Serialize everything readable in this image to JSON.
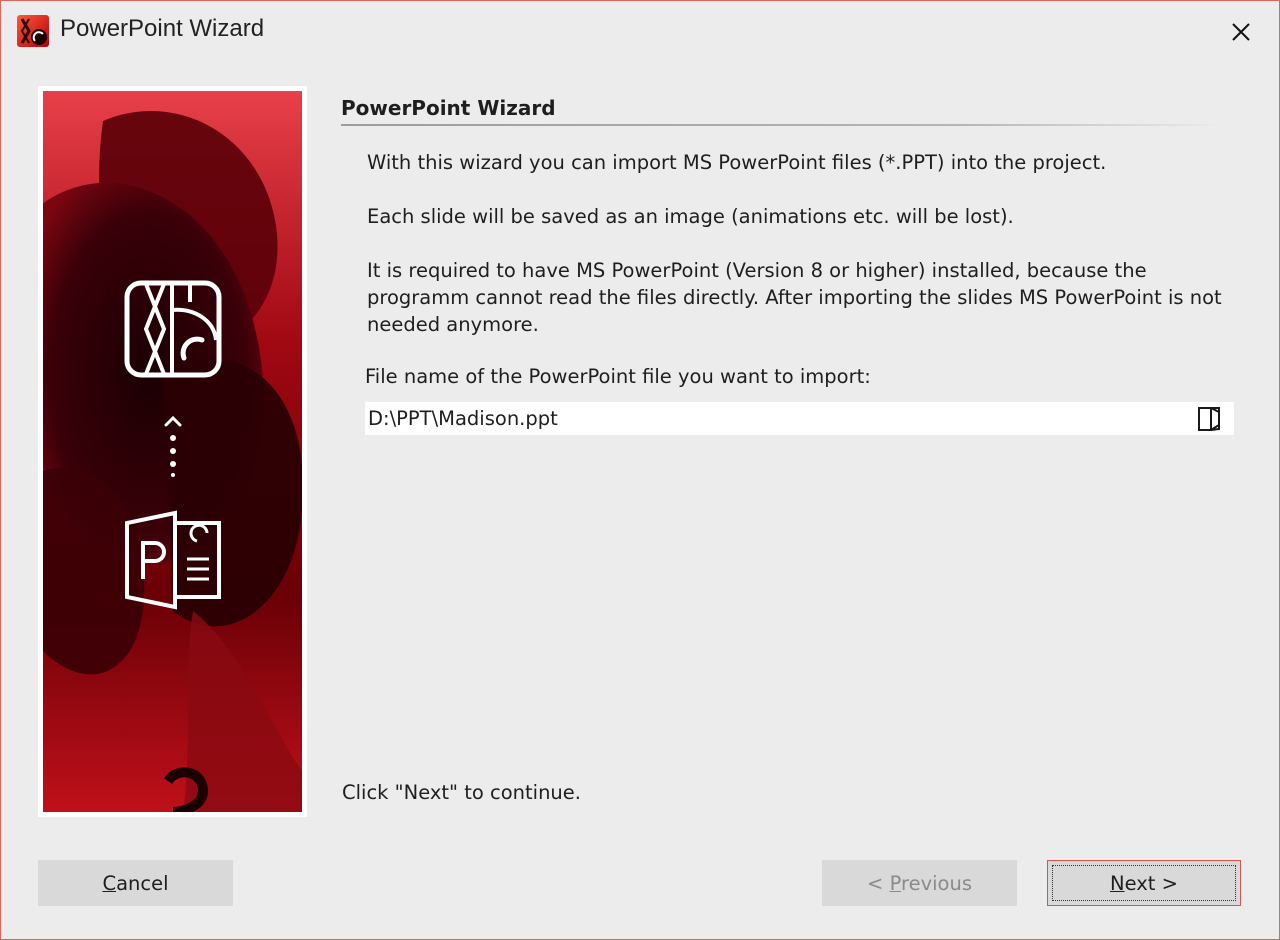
{
  "window": {
    "title": "PowerPoint Wizard",
    "close_icon": "close-icon",
    "accent": "#e0655a"
  },
  "section": {
    "title": "PowerPoint Wizard"
  },
  "paragraphs": [
    "With this wizard you can import MS PowerPoint files (*.PPT) into the project.",
    "Each slide will be saved as an image (animations etc. will be lost).",
    "It is required to have MS PowerPoint (Version 8 or higher) installed, because the programm cannot read the files directly. After importing the slides MS PowerPoint is not needed anymore."
  ],
  "file": {
    "label": "File name of the PowerPoint file you want to import:",
    "value": "D:\\PPT\\Madison.ppt",
    "browse_icon": "folder-open-icon"
  },
  "hint": "Click \"Next\" to continue.",
  "buttons": {
    "cancel": {
      "accel": "C",
      "rest": "ancel"
    },
    "previous": {
      "prefix": "< ",
      "accel": "P",
      "rest": "revious",
      "enabled": false
    },
    "next": {
      "accel": "N",
      "rest": "ext >",
      "default": true
    }
  },
  "side_panel": {
    "icons": [
      "app-logo-icon",
      "dotted-arrow-up-icon",
      "powerpoint-icon"
    ],
    "colors": {
      "primary": "#c0101a",
      "dark": "#2a0004"
    }
  }
}
